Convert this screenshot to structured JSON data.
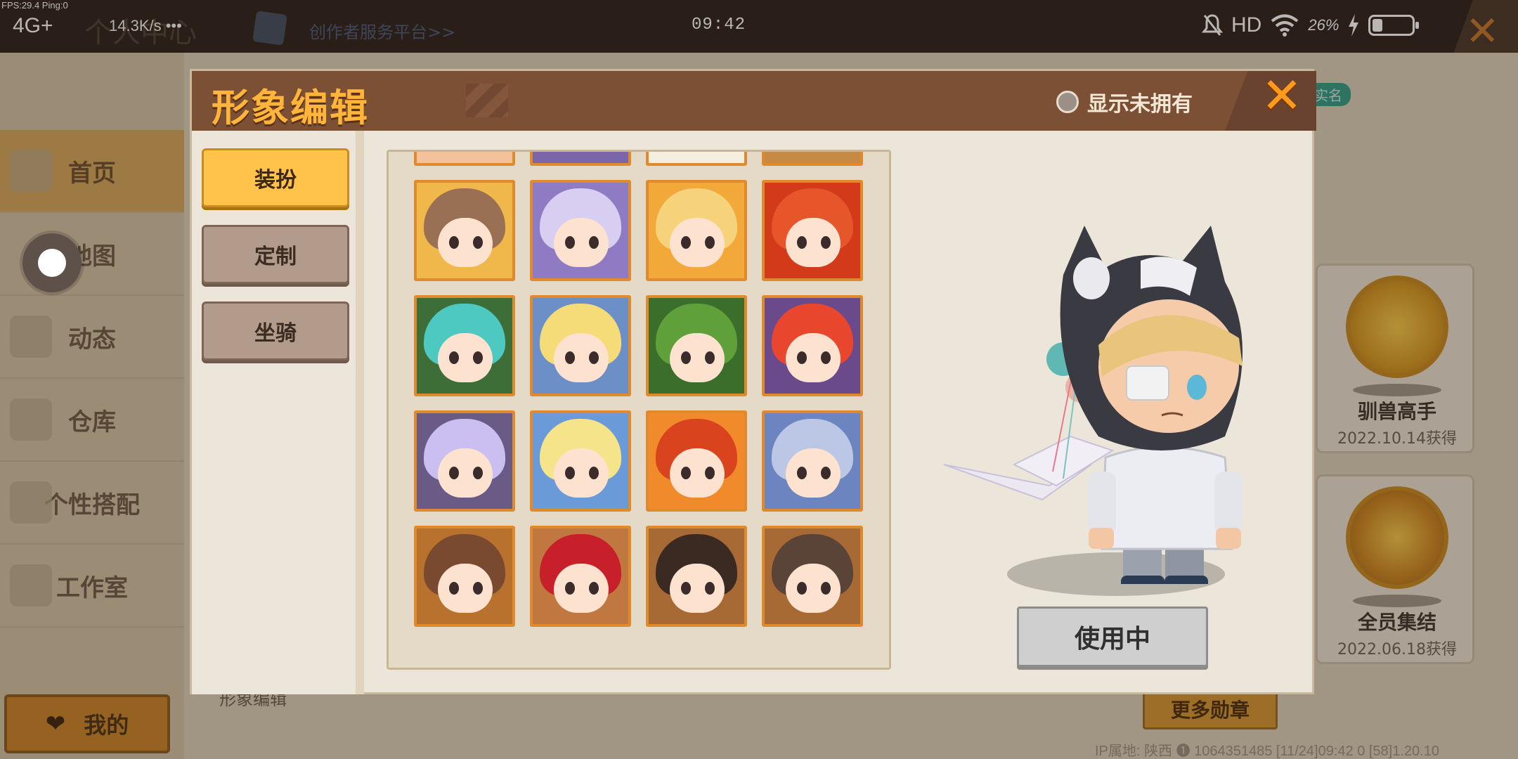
{
  "status_bar": {
    "fps": "FPS:29.4  Ping:0",
    "network": "4G+",
    "speed": "14.3K/s",
    "dots": "•••",
    "time": "09:42",
    "hd": "HD",
    "battery": "26%",
    "battery_level": 0.26
  },
  "background": {
    "page_title": "个人中心",
    "platform_link": "创作者服务平台>>",
    "realname_badge": "实名",
    "menu": [
      "首页",
      "地图",
      "动态",
      "仓库",
      "个性搭配",
      "工作室"
    ],
    "active_menu_index": 0,
    "my_button": "我的",
    "section_label": "形象编辑",
    "medals": [
      {
        "name": "驯兽高手",
        "date": "2022.10.14获得"
      },
      {
        "name": "全员集结",
        "date": "2022.06.18获得"
      }
    ],
    "more_medals": "更多勋章",
    "ip_info": "IP属地: 陕西 ❶  1064351485  [11/24]09:42 0  [58]1.20.10"
  },
  "modal": {
    "title": "形象编辑",
    "show_unowned": "显示未拥有",
    "show_unowned_checked": false,
    "close_icon": "close-x-icon",
    "tabs": [
      "装扮",
      "定制",
      "坐骑"
    ],
    "selected_tab_index": 0,
    "in_use_button": "使用中"
  },
  "avatars": [
    {
      "hair": "#f07a2a",
      "bg": "#f4c29a"
    },
    {
      "hair": "#b7a6e0",
      "bg": "#7a66a8"
    },
    {
      "hair": "#f3dcc0",
      "bg": "#f6eee0"
    },
    {
      "hair": "#6b4a38",
      "bg": "#c68a44"
    },
    {
      "hair": "#9a7055",
      "bg": "#f0b84a"
    },
    {
      "hair": "#d7cef2",
      "bg": "#8f7ac4"
    },
    {
      "hair": "#f6d27a",
      "bg": "#f3a83a"
    },
    {
      "hair": "#e7552a",
      "bg": "#d23a1a"
    },
    {
      "hair": "#4ec9c2",
      "bg": "#3e6e38"
    },
    {
      "hair": "#f5dc78",
      "bg": "#6d8fc7"
    },
    {
      "hair": "#5fa03a",
      "bg": "#3b6e2a"
    },
    {
      "hair": "#e8472e",
      "bg": "#6a4a8a"
    },
    {
      "hair": "#cabff0",
      "bg": "#6a5a86"
    },
    {
      "hair": "#f6e48a",
      "bg": "#6a9ad8"
    },
    {
      "hair": "#d9431e",
      "bg": "#f08a2a"
    },
    {
      "hair": "#bcc7e6",
      "bg": "#6c84c0"
    },
    {
      "hair": "#7a4a30",
      "bg": "#b8722e"
    },
    {
      "hair": "#c8202a",
      "bg": "#c07840"
    },
    {
      "hair": "#3a2a22",
      "bg": "#a86a34"
    },
    {
      "hair": "#5a4438",
      "bg": "#a86a34"
    }
  ]
}
